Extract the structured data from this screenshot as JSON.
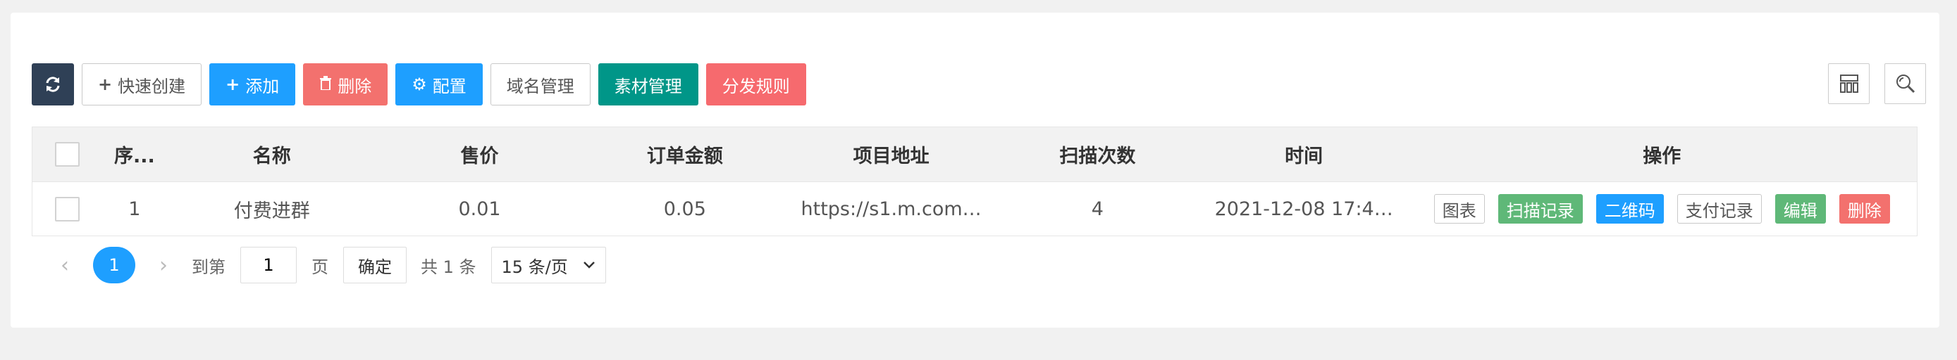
{
  "toolbar": {
    "refresh_icon": "refresh-icon",
    "quick_create": "快速创建",
    "add": "添加",
    "delete": "删除",
    "config": "配置",
    "domain": "域名管理",
    "material": "素材管理",
    "rules": "分发规则"
  },
  "right_tools": {
    "columns_icon": "columns-icon",
    "search_icon": "search-icon"
  },
  "table": {
    "columns": [
      "序...",
      "名称",
      "售价",
      "订单金额",
      "项目地址",
      "扫描次数",
      "时间",
      "操作"
    ],
    "rows": [
      {
        "seq": "1",
        "name": "付费进群",
        "price": "0.01",
        "amount": "0.05",
        "url": "https://s1.m.com…",
        "scans": "4",
        "time": "2021-12-08 17:4…",
        "ops": [
          "图表",
          "扫描记录",
          "二维码",
          "支付记录",
          "编辑",
          "删除"
        ]
      }
    ]
  },
  "pager": {
    "current": "1",
    "goto_label": "到第",
    "goto_value": "1",
    "page_label": "页",
    "confirm": "确定",
    "total": "共 1 条",
    "page_size": "15 条/页"
  },
  "colors": {
    "dark": "#2f4056",
    "blue": "#1e9fff",
    "red": "#f3716e",
    "teal": "#009688",
    "green": "#5fb878",
    "annotation_arrow": "#e53935"
  }
}
